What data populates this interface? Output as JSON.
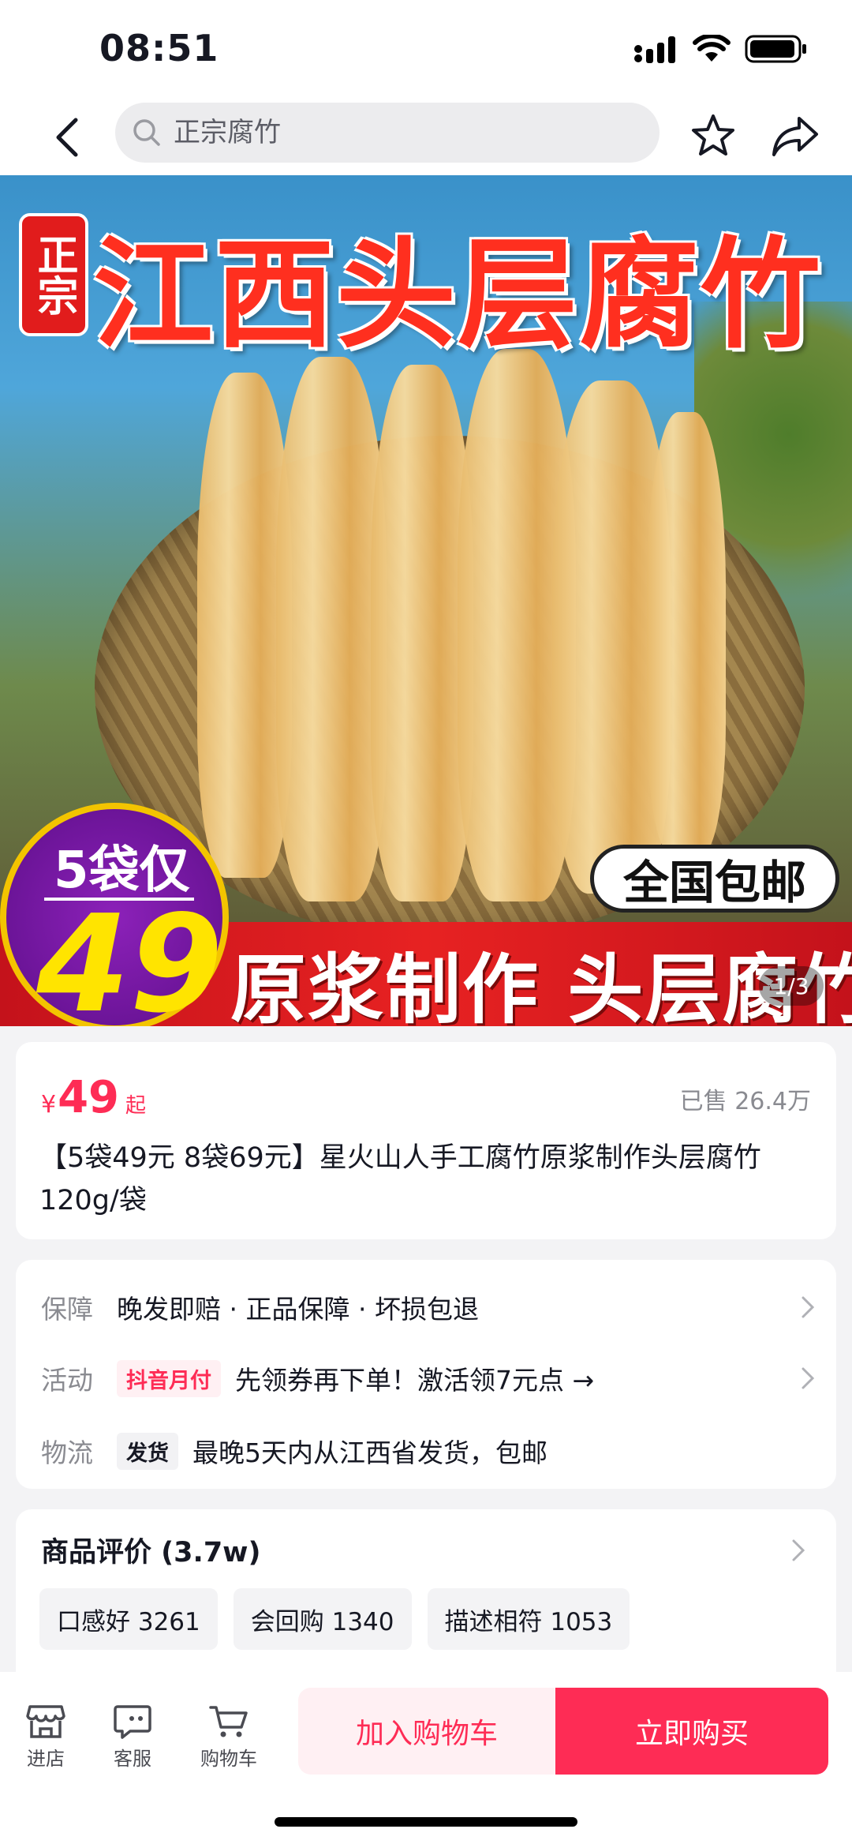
{
  "status": {
    "time": "08:51"
  },
  "nav": {
    "search_placeholder": "正宗腐竹"
  },
  "hero": {
    "tag": "正宗",
    "headline": "江西头层腐竹",
    "badge_line1": "5袋仅",
    "badge_line2": "49",
    "free_shipping": "全国包邮",
    "bottom_slogan": "原浆制作 头层腐竹",
    "counter": "1/3"
  },
  "product": {
    "currency": "¥",
    "price": "49",
    "price_suffix": "起",
    "sold": "已售 26.4万",
    "title": "【5袋49元 8袋69元】星火山人手工腐竹原浆制作头层腐竹 120g/袋"
  },
  "service": {
    "guarantee_label": "保障",
    "guarantee_value": "晚发即赔 · 正品保障 · 坏损包退",
    "promo_label": "活动",
    "promo_tag": "抖音月付",
    "promo_value": "先领券再下单！激活领7元点 →",
    "logistics_label": "物流",
    "logistics_tag": "发货",
    "logistics_value": "最晚5天内从江西省发货，包邮"
  },
  "reviews": {
    "title": "商品评价 (3.7w)",
    "chips": [
      "口感好 3261",
      "会回购 1340",
      "描述相符 1053"
    ]
  },
  "bottom": {
    "shop": "进店",
    "service": "客服",
    "cart": "购物车",
    "add_to_cart": "加入购物车",
    "buy_now": "立即购买"
  },
  "colors": {
    "accent": "#fe2c55",
    "text_primary": "#161823",
    "text_secondary": "#8a8b91",
    "page_bg": "#f3f3f5"
  }
}
